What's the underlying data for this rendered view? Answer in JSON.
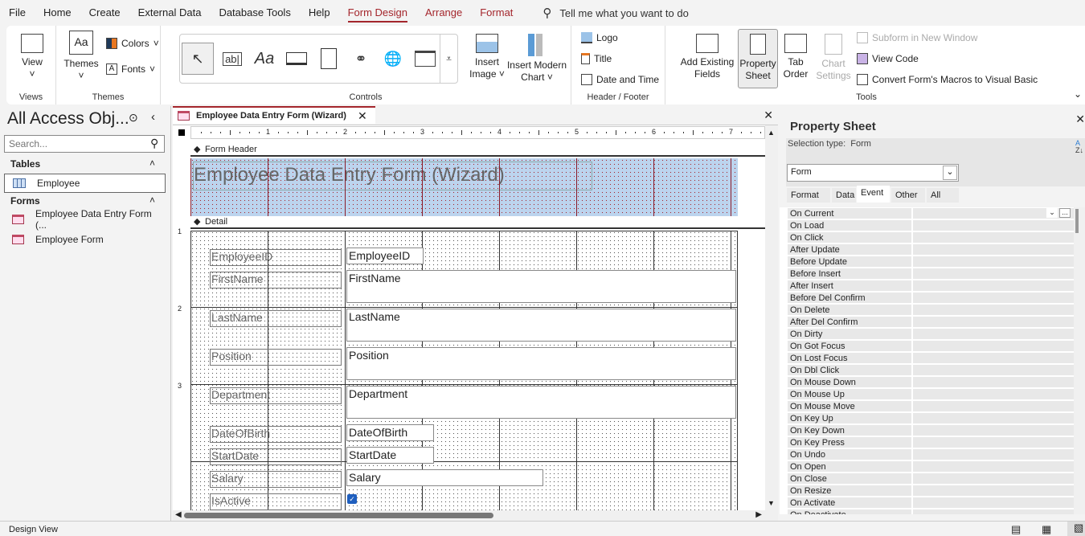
{
  "menu": {
    "items": [
      "File",
      "Home",
      "Create",
      "External Data",
      "Database Tools",
      "Help"
    ],
    "contextual": [
      "Form Design",
      "Arrange",
      "Format"
    ],
    "active": "Form Design",
    "tell_me": "Tell me what you want to do"
  },
  "ribbon": {
    "views": {
      "view": "View",
      "label": "Views"
    },
    "themes": {
      "themes": "Themes",
      "colors": "Colors",
      "fonts": "Fonts",
      "label": "Themes"
    },
    "controls": {
      "label": "Controls",
      "gallery": [
        "select-pointer",
        "text-box",
        "label-aa",
        "button",
        "tab-control",
        "hyperlink",
        "web-browser",
        "navigation-control"
      ],
      "insert_image": [
        "Insert",
        "Image"
      ],
      "insert_chart": [
        "Insert Modern",
        "Chart"
      ]
    },
    "header_footer": {
      "logo": "Logo",
      "title": "Title",
      "date_time": "Date and Time",
      "label": "Header / Footer"
    },
    "tools": {
      "add_fields": [
        "Add Existing",
        "Fields"
      ],
      "property_sheet": [
        "Property",
        "Sheet"
      ],
      "tab_order": [
        "Tab",
        "Order"
      ],
      "chart_settings": [
        "Chart",
        "Settings"
      ],
      "subform": "Subform in New Window",
      "view_code": "View Code",
      "convert": "Convert Form's Macros to Visual Basic",
      "label": "Tools"
    }
  },
  "nav": {
    "title": "All Access Obj...",
    "search_placeholder": "Search...",
    "groups": [
      {
        "name": "Tables",
        "items": [
          "Employee"
        ]
      },
      {
        "name": "Forms",
        "items": [
          "Employee Data Entry Form (...",
          "Employee Form"
        ]
      }
    ]
  },
  "document": {
    "tab_title": "Employee Data Entry Form (Wizard)",
    "ruler": [
      "1",
      "2",
      "3",
      "4",
      "5",
      "6",
      "7"
    ],
    "vruler": [
      "1",
      "2",
      "3"
    ],
    "form_header": "Form Header",
    "detail": "Detail",
    "form_title": "Employee Data Entry Form (Wizard)",
    "fields": [
      {
        "label": "EmployeeID",
        "value": "EmployeeID"
      },
      {
        "label": "FirstName",
        "value": "FirstName"
      },
      {
        "label": "LastName",
        "value": "LastName"
      },
      {
        "label": "Position",
        "value": "Position"
      },
      {
        "label": "Department",
        "value": "Department"
      },
      {
        "label": "DateOfBirth",
        "value": "DateOfBirth"
      },
      {
        "label": "StartDate",
        "value": "StartDate"
      },
      {
        "label": "Salary",
        "value": "Salary"
      },
      {
        "label": "IsActive",
        "value": ""
      }
    ],
    "isactive_checked": true
  },
  "property_sheet": {
    "title": "Property Sheet",
    "selection_type_label": "Selection type:",
    "selection_type": "Form",
    "selector": "Form",
    "tabs": [
      "Format",
      "Data",
      "Event",
      "Other",
      "All"
    ],
    "active_tab": "Event",
    "events": [
      "On Current",
      "On Load",
      "On Click",
      "After Update",
      "Before Update",
      "Before Insert",
      "After Insert",
      "Before Del Confirm",
      "On Delete",
      "After Del Confirm",
      "On Dirty",
      "On Got Focus",
      "On Lost Focus",
      "On Dbl Click",
      "On Mouse Down",
      "On Mouse Up",
      "On Mouse Move",
      "On Key Up",
      "On Key Down",
      "On Key Press",
      "On Undo",
      "On Open",
      "On Close",
      "On Resize",
      "On Activate",
      "On Deactivate"
    ]
  },
  "status": {
    "text": "Design View"
  },
  "colors": {
    "accent": "#a4262c",
    "header_fill": "#bcd4ee"
  }
}
